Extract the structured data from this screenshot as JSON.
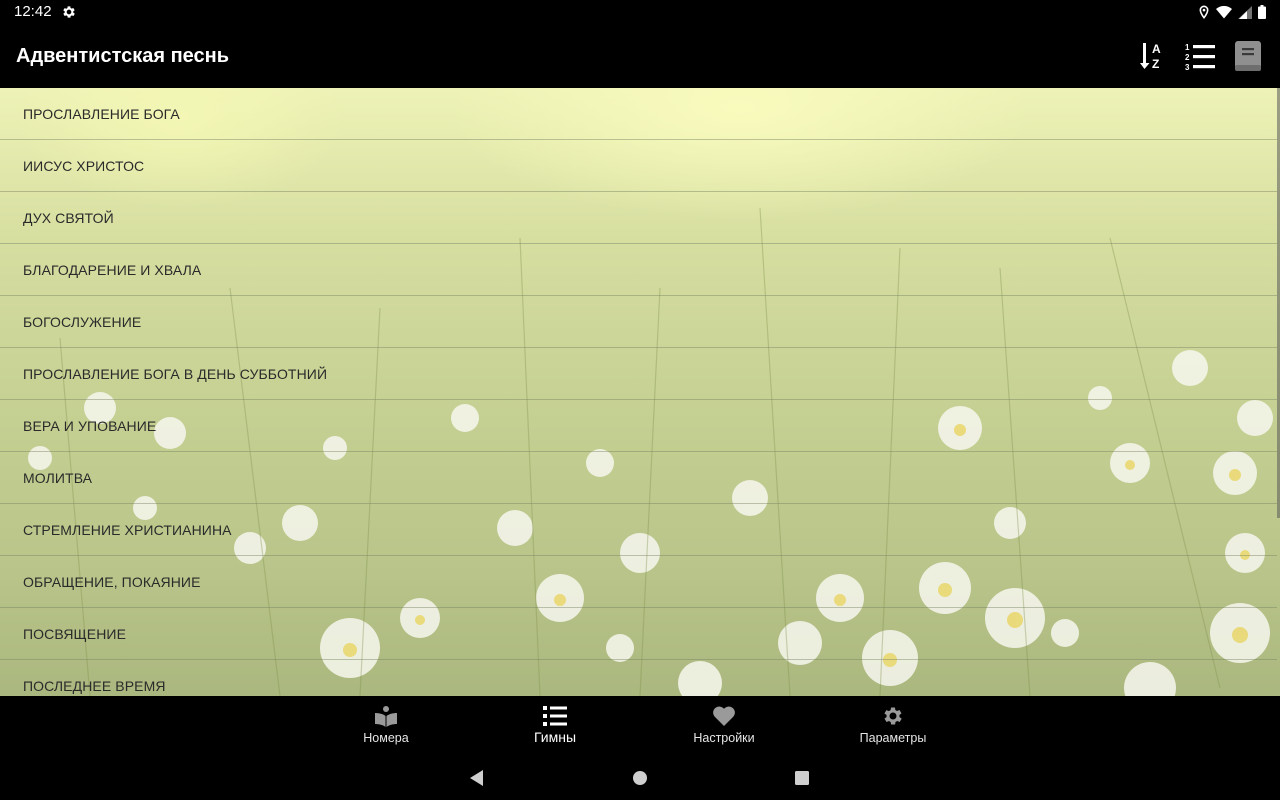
{
  "status_bar": {
    "time": "12:42"
  },
  "app_bar": {
    "title": "Адвентистская песнь",
    "actions": [
      "sort-alpha-icon",
      "numbered-list-icon",
      "book-icon"
    ]
  },
  "categories": [
    "ПРОСЛАВЛЕНИЕ БОГА",
    "ИИСУС ХРИСТОС",
    "ДУХ СВЯТОЙ",
    "БЛАГОДАРЕНИЕ И ХВАЛА",
    "БОГОСЛУЖЕНИЕ",
    "ПРОСЛАВЛЕНИЕ БОГА В ДЕНЬ СУББОТНИЙ",
    "ВЕРА И УПОВАНИЕ",
    "МОЛИТВА",
    "СТРЕМЛЕНИЕ ХРИСТИАНИНА",
    "ОБРАЩЕНИЕ, ПОКАЯНИЕ",
    "ПОСВЯЩЕНИЕ",
    "ПОСЛЕДНЕЕ ВРЕМЯ"
  ],
  "bottom_nav": [
    {
      "label": "Номера",
      "icon": "open-book-icon",
      "active": false
    },
    {
      "label": "Гимны",
      "icon": "list-icon",
      "active": true
    },
    {
      "label": "Настройки",
      "icon": "heart-icon",
      "active": false
    },
    {
      "label": "Параметры",
      "icon": "gear-icon",
      "active": false
    }
  ],
  "colors": {
    "bar": "#000000",
    "list_text": "#2a2a2a",
    "nav_active": "#ffffff",
    "nav_inactive": "#e6e6e6"
  }
}
